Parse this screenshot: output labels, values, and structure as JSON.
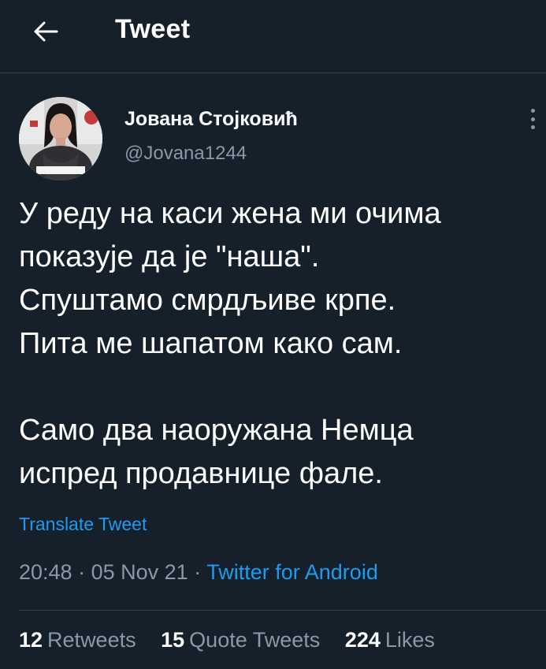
{
  "header": {
    "title": "Tweet",
    "back_icon": "arrow-left-icon"
  },
  "author": {
    "name": "Јована Стојковић",
    "handle": "@Jovana1244"
  },
  "tweet": {
    "lines": [
      "У реду на каси жена ми очима",
      "показује да је \"наша\".",
      "Спуштамо смрдљиве крпе.",
      "Пита ме шапатом како сам.",
      "",
      "Само два наоружана Немца",
      "испред продавнице фале."
    ],
    "translate_label": "Translate Tweet",
    "time": "20:48",
    "date": "05 Nov 21",
    "separator": "·",
    "source": "Twitter for Android"
  },
  "stats": {
    "retweets_count": "12",
    "retweets_label": "Retweets",
    "quotes_count": "15",
    "quotes_label": "Quote Tweets",
    "likes_count": "224",
    "likes_label": "Likes"
  },
  "colors": {
    "background": "#15202b",
    "accent": "#1d9bf0",
    "secondary_text": "#8b98a5",
    "divider": "#38444d"
  }
}
